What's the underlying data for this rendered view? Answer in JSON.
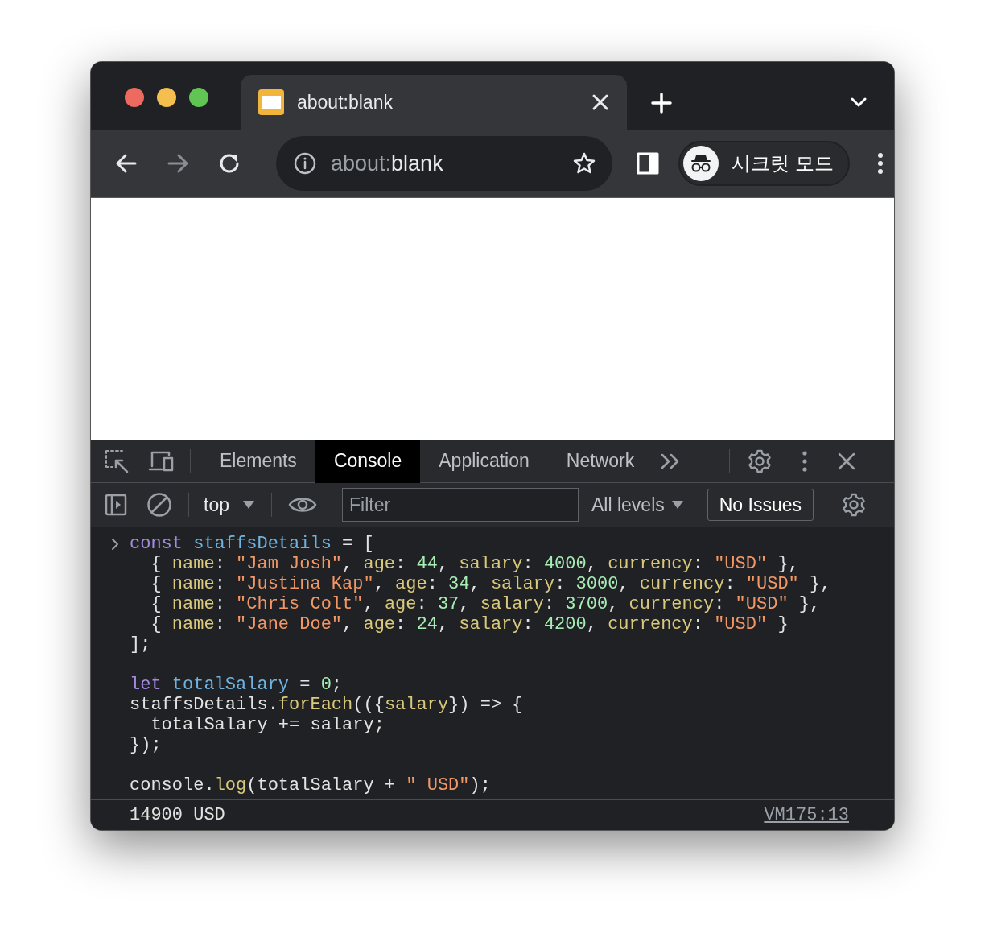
{
  "traffic_lights": [
    {
      "color": "#ed6a5e"
    },
    {
      "color": "#f5bf4f"
    },
    {
      "color": "#61c554"
    }
  ],
  "tabs": [
    {
      "title": "about:blank",
      "selected": true
    }
  ],
  "nav": {
    "back_disabled": false,
    "forward_disabled": true
  },
  "address": {
    "dim": "about:",
    "main": "blank"
  },
  "profile": {
    "label": "시크릿 모드"
  },
  "devtools_tabs": [
    {
      "label": "Elements",
      "selected": false
    },
    {
      "label": "Console",
      "selected": true
    },
    {
      "label": "Application",
      "selected": false
    },
    {
      "label": "Network",
      "selected": false
    }
  ],
  "console_bar": {
    "context": "top",
    "filter_placeholder": "Filter",
    "levels": "All levels",
    "issues": "No Issues"
  },
  "input_lines": [
    {
      "tokens": [
        {
          "kind": "keyword",
          "text": "const"
        },
        {
          "kind": "variable",
          "text": " staffsDetails"
        },
        {
          "kind": "plain",
          "text": " = ["
        }
      ]
    },
    {
      "tokens": [
        {
          "kind": "plain",
          "text": "  { "
        },
        {
          "kind": "property",
          "text": "name"
        },
        {
          "kind": "plain",
          "text": ": "
        },
        {
          "kind": "string",
          "text": "\"Jam Josh\""
        },
        {
          "kind": "plain",
          "text": ", "
        },
        {
          "kind": "property",
          "text": "age"
        },
        {
          "kind": "plain",
          "text": ": "
        },
        {
          "kind": "number",
          "text": "44"
        },
        {
          "kind": "plain",
          "text": ", "
        },
        {
          "kind": "property",
          "text": "salary"
        },
        {
          "kind": "plain",
          "text": ": "
        },
        {
          "kind": "number",
          "text": "4000"
        },
        {
          "kind": "plain",
          "text": ", "
        },
        {
          "kind": "property",
          "text": "currency"
        },
        {
          "kind": "plain",
          "text": ": "
        },
        {
          "kind": "string",
          "text": "\"USD\""
        },
        {
          "kind": "plain",
          "text": " },"
        }
      ]
    },
    {
      "tokens": [
        {
          "kind": "plain",
          "text": "  { "
        },
        {
          "kind": "property",
          "text": "name"
        },
        {
          "kind": "plain",
          "text": ": "
        },
        {
          "kind": "string",
          "text": "\"Justina Kap\""
        },
        {
          "kind": "plain",
          "text": ", "
        },
        {
          "kind": "property",
          "text": "age"
        },
        {
          "kind": "plain",
          "text": ": "
        },
        {
          "kind": "number",
          "text": "34"
        },
        {
          "kind": "plain",
          "text": ", "
        },
        {
          "kind": "property",
          "text": "salary"
        },
        {
          "kind": "plain",
          "text": ": "
        },
        {
          "kind": "number",
          "text": "3000"
        },
        {
          "kind": "plain",
          "text": ", "
        },
        {
          "kind": "property",
          "text": "currency"
        },
        {
          "kind": "plain",
          "text": ": "
        },
        {
          "kind": "string",
          "text": "\"USD\""
        },
        {
          "kind": "plain",
          "text": " },"
        }
      ]
    },
    {
      "tokens": [
        {
          "kind": "plain",
          "text": "  { "
        },
        {
          "kind": "property",
          "text": "name"
        },
        {
          "kind": "plain",
          "text": ": "
        },
        {
          "kind": "string",
          "text": "\"Chris Colt\""
        },
        {
          "kind": "plain",
          "text": ", "
        },
        {
          "kind": "property",
          "text": "age"
        },
        {
          "kind": "plain",
          "text": ": "
        },
        {
          "kind": "number",
          "text": "37"
        },
        {
          "kind": "plain",
          "text": ", "
        },
        {
          "kind": "property",
          "text": "salary"
        },
        {
          "kind": "plain",
          "text": ": "
        },
        {
          "kind": "number",
          "text": "3700"
        },
        {
          "kind": "plain",
          "text": ", "
        },
        {
          "kind": "property",
          "text": "currency"
        },
        {
          "kind": "plain",
          "text": ": "
        },
        {
          "kind": "string",
          "text": "\"USD\""
        },
        {
          "kind": "plain",
          "text": " },"
        }
      ]
    },
    {
      "tokens": [
        {
          "kind": "plain",
          "text": "  { "
        },
        {
          "kind": "property",
          "text": "name"
        },
        {
          "kind": "plain",
          "text": ": "
        },
        {
          "kind": "string",
          "text": "\"Jane Doe\""
        },
        {
          "kind": "plain",
          "text": ", "
        },
        {
          "kind": "property",
          "text": "age"
        },
        {
          "kind": "plain",
          "text": ": "
        },
        {
          "kind": "number",
          "text": "24"
        },
        {
          "kind": "plain",
          "text": ", "
        },
        {
          "kind": "property",
          "text": "salary"
        },
        {
          "kind": "plain",
          "text": ": "
        },
        {
          "kind": "number",
          "text": "4200"
        },
        {
          "kind": "plain",
          "text": ", "
        },
        {
          "kind": "property",
          "text": "currency"
        },
        {
          "kind": "plain",
          "text": ": "
        },
        {
          "kind": "string",
          "text": "\"USD\""
        },
        {
          "kind": "plain",
          "text": " }"
        }
      ]
    },
    {
      "tokens": [
        {
          "kind": "plain",
          "text": "];"
        }
      ]
    },
    {
      "blank_before": true,
      "tokens": [
        {
          "kind": "keyword",
          "text": "let"
        },
        {
          "kind": "variable",
          "text": " totalSalary"
        },
        {
          "kind": "plain",
          "text": " = "
        },
        {
          "kind": "number",
          "text": "0"
        },
        {
          "kind": "plain",
          "text": ";"
        }
      ]
    },
    {
      "tokens": [
        {
          "kind": "plain",
          "text": "staffsDetails."
        },
        {
          "kind": "method",
          "text": "forEach"
        },
        {
          "kind": "plain",
          "text": "(({"
        },
        {
          "kind": "property",
          "text": "salary"
        },
        {
          "kind": "plain",
          "text": "}) => {"
        }
      ]
    },
    {
      "tokens": [
        {
          "kind": "plain",
          "text": "  totalSalary += salary;"
        }
      ]
    },
    {
      "tokens": [
        {
          "kind": "plain",
          "text": "});"
        }
      ]
    },
    {
      "blank_before": true,
      "tokens": [
        {
          "kind": "plain",
          "text": "console."
        },
        {
          "kind": "method",
          "text": "log"
        },
        {
          "kind": "plain",
          "text": "(totalSalary + "
        },
        {
          "kind": "string",
          "text": "\" USD\""
        },
        {
          "kind": "plain",
          "text": ");"
        }
      ]
    }
  ],
  "output": {
    "text": "14900 USD",
    "source": "VM175:13"
  }
}
